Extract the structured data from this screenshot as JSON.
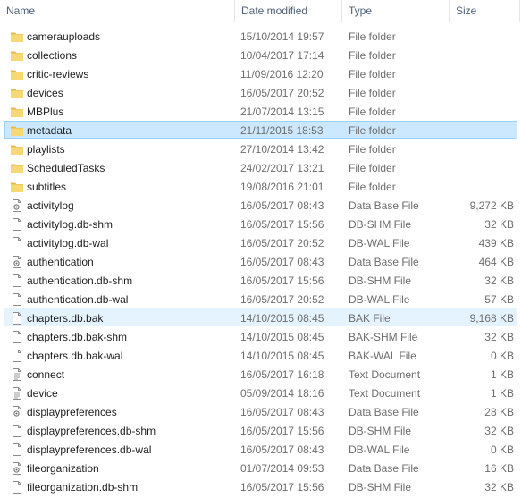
{
  "columns": {
    "name": "Name",
    "date": "Date modified",
    "type": "Type",
    "size": "Size"
  },
  "colors": {
    "selected": "#cce8ff",
    "selected_border": "#99d1ff",
    "hover": "#e5f3ff",
    "folder": "#f8d775"
  },
  "files": [
    {
      "name": "camerauploads",
      "date": "15/10/2014 19:57",
      "type": "File folder",
      "size": "",
      "icon": "folder-icon"
    },
    {
      "name": "collections",
      "date": "10/04/2017 17:14",
      "type": "File folder",
      "size": "",
      "icon": "folder-icon"
    },
    {
      "name": "critic-reviews",
      "date": "11/09/2016 12:20",
      "type": "File folder",
      "size": "",
      "icon": "folder-icon"
    },
    {
      "name": "devices",
      "date": "16/05/2017 20:52",
      "type": "File folder",
      "size": "",
      "icon": "folder-icon"
    },
    {
      "name": "MBPlus",
      "date": "21/07/2014 13:15",
      "type": "File folder",
      "size": "",
      "icon": "folder-icon"
    },
    {
      "name": "metadata",
      "date": "21/11/2015 18:53",
      "type": "File folder",
      "size": "",
      "icon": "folder-icon",
      "state": "selected"
    },
    {
      "name": "playlists",
      "date": "27/10/2014 13:42",
      "type": "File folder",
      "size": "",
      "icon": "folder-icon"
    },
    {
      "name": "ScheduledTasks",
      "date": "24/02/2017 13:21",
      "type": "File folder",
      "size": "",
      "icon": "folder-icon"
    },
    {
      "name": "subtitles",
      "date": "19/08/2016 21:01",
      "type": "File folder",
      "size": "",
      "icon": "folder-icon"
    },
    {
      "name": "activitylog",
      "date": "16/05/2017 08:43",
      "type": "Data Base File",
      "size": "9,272 KB",
      "icon": "database-file-icon"
    },
    {
      "name": "activitylog.db-shm",
      "date": "16/05/2017 15:56",
      "type": "DB-SHM File",
      "size": "32 KB",
      "icon": "file-icon"
    },
    {
      "name": "activitylog.db-wal",
      "date": "16/05/2017 20:52",
      "type": "DB-WAL File",
      "size": "439 KB",
      "icon": "file-icon"
    },
    {
      "name": "authentication",
      "date": "16/05/2017 08:43",
      "type": "Data Base File",
      "size": "464 KB",
      "icon": "database-file-icon"
    },
    {
      "name": "authentication.db-shm",
      "date": "16/05/2017 15:56",
      "type": "DB-SHM File",
      "size": "32 KB",
      "icon": "file-icon"
    },
    {
      "name": "authentication.db-wal",
      "date": "16/05/2017 20:52",
      "type": "DB-WAL File",
      "size": "57 KB",
      "icon": "file-icon"
    },
    {
      "name": "chapters.db.bak",
      "date": "14/10/2015 08:45",
      "type": "BAK File",
      "size": "9,168 KB",
      "icon": "file-icon",
      "state": "hover"
    },
    {
      "name": "chapters.db.bak-shm",
      "date": "14/10/2015 08:45",
      "type": "BAK-SHM File",
      "size": "32 KB",
      "icon": "file-icon"
    },
    {
      "name": "chapters.db.bak-wal",
      "date": "14/10/2015 08:45",
      "type": "BAK-WAL File",
      "size": "0 KB",
      "icon": "file-icon"
    },
    {
      "name": "connect",
      "date": "16/05/2017 16:18",
      "type": "Text Document",
      "size": "1 KB",
      "icon": "text-document-icon"
    },
    {
      "name": "device",
      "date": "05/09/2014 18:16",
      "type": "Text Document",
      "size": "1 KB",
      "icon": "text-document-icon"
    },
    {
      "name": "displaypreferences",
      "date": "16/05/2017 08:43",
      "type": "Data Base File",
      "size": "28 KB",
      "icon": "database-file-icon"
    },
    {
      "name": "displaypreferences.db-shm",
      "date": "16/05/2017 15:56",
      "type": "DB-SHM File",
      "size": "32 KB",
      "icon": "file-icon"
    },
    {
      "name": "displaypreferences.db-wal",
      "date": "16/05/2017 08:43",
      "type": "DB-WAL File",
      "size": "0 KB",
      "icon": "file-icon"
    },
    {
      "name": "fileorganization",
      "date": "01/07/2014 09:53",
      "type": "Data Base File",
      "size": "16 KB",
      "icon": "database-file-icon"
    },
    {
      "name": "fileorganization.db-shm",
      "date": "16/05/2017 15:56",
      "type": "DB-SHM File",
      "size": "32 KB",
      "icon": "file-icon"
    }
  ]
}
